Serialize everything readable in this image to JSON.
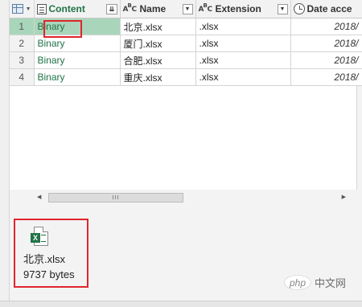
{
  "columns": {
    "content": "Content",
    "name": "Name",
    "extension": "Extension",
    "date_accessed": "Date acce"
  },
  "rows": [
    {
      "index": "1",
      "content": "Binary",
      "name": "北京.xlsx",
      "extension": ".xlsx",
      "date": "2018/"
    },
    {
      "index": "2",
      "content": "Binary",
      "name": "厦门.xlsx",
      "extension": ".xlsx",
      "date": "2018/"
    },
    {
      "index": "3",
      "content": "Binary",
      "name": "合肥.xlsx",
      "extension": ".xlsx",
      "date": "2018/"
    },
    {
      "index": "4",
      "content": "Binary",
      "name": "重庆.xlsx",
      "extension": ".xlsx",
      "date": "2018/"
    }
  ],
  "selected_row": 1,
  "preview": {
    "file_name": "北京.xlsx",
    "file_size": "9737 bytes",
    "icon": "excel-file-icon"
  },
  "watermark": {
    "logo": "php",
    "text": "中文网"
  },
  "colors": {
    "selection": "#a9d6bb",
    "binary_text": "#217346",
    "highlight_border": "#e0252d"
  }
}
